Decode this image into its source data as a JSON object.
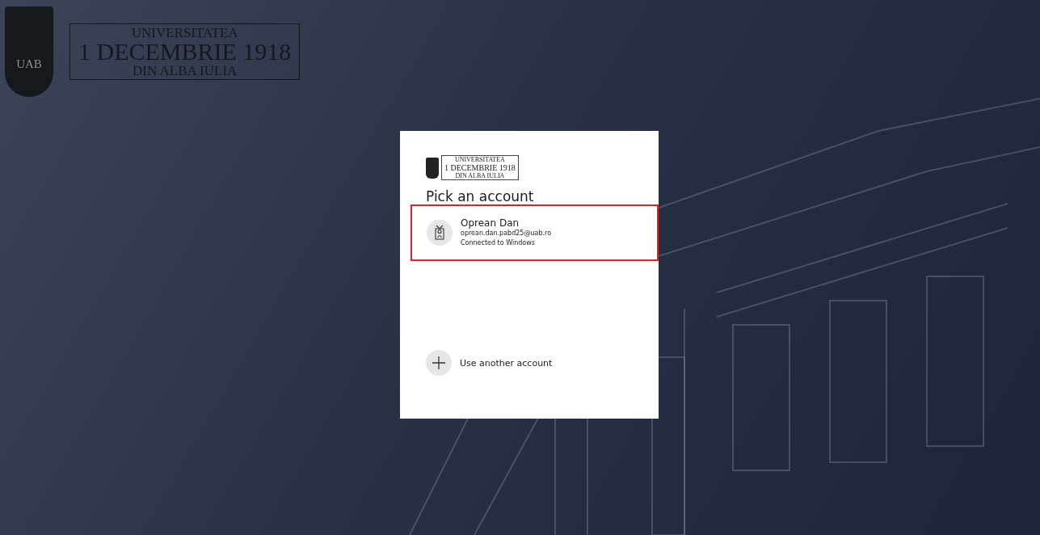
{
  "brand": {
    "lines": [
      "UNIVERSITATEA",
      "1 DECEMBRIE 1918",
      "DIN ALBA IULIA"
    ],
    "shield_text": "UAB"
  },
  "dialog": {
    "logo_lines": [
      "UNIVERSITATEA",
      "1 DECEMBRIE 1918",
      "DIN ALBA IULIA"
    ],
    "title": "Pick an account",
    "accounts": [
      {
        "name": "Oprean Dan",
        "email": "oprean.dan.pabd25@uab.ro",
        "status": "Connected to Windows",
        "highlighted": true
      }
    ],
    "other_option": "Use another account"
  }
}
